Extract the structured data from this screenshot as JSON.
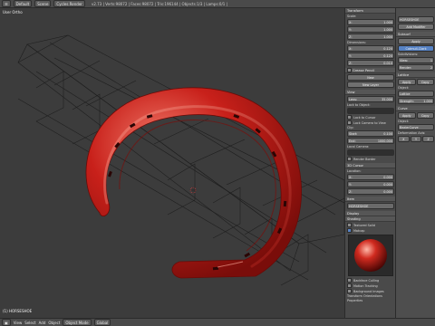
{
  "topbar": {
    "editor_menu": "Default",
    "scene": "Scene",
    "engine": "Cycles Render",
    "stats": "v2.73 | Verts:98072 | Faces:98072 | Tris:196144 | Objects:1/3 | Lamps:0/1 | Mem:44.72M | HORSESHOE"
  },
  "viewport": {
    "label": "User Ortho",
    "object_label": "(1) HORSESHOE"
  },
  "npanel": {
    "header_transform": "Transform",
    "scale_label": "Scale:",
    "scale": [
      {
        "axis": "X:",
        "value": "1.000"
      },
      {
        "axis": "Y:",
        "value": "1.000"
      },
      {
        "axis": "Z:",
        "value": "1.000"
      }
    ],
    "dimensions_label": "Dimensions:",
    "dimensions": [
      {
        "axis": "X:",
        "value": "0.120"
      },
      {
        "axis": "Y:",
        "value": "0.120"
      },
      {
        "axis": "Z:",
        "value": "0.010"
      }
    ],
    "grease_pencil": "Grease Pencil",
    "new_btn": "New",
    "new_layer_btn": "New Layer",
    "view_header": "View",
    "lens_label": "Lens:",
    "lens_value": "35.000",
    "lock_to_object": "Lock to Object:",
    "lock_to_cursor": "Lock to Cursor",
    "lock_camera": "Lock Camera to View",
    "clip_label": "Clip:",
    "clip_start": "0.100",
    "clip_end": "1000.000",
    "local_camera": "Local Camera:",
    "render_border": "Render Border",
    "cursor_3d": "3D Cursor",
    "location_label": "Location:",
    "location": [
      {
        "axis": "X:",
        "value": "0.000"
      },
      {
        "axis": "Y:",
        "value": "0.000"
      },
      {
        "axis": "Z:",
        "value": "0.000"
      }
    ],
    "item_header": "Item",
    "item_name": "HORSESHOE",
    "display": "Display",
    "shading": "Shading",
    "textured_solid": "Textured Solid",
    "matcap": "Matcap",
    "backface_culling": "Backface Culling",
    "motion_tracking": "Motion Tracking",
    "background_images": "Background Images",
    "transform_orientations": "Transform Orientations",
    "properties": "Properties"
  },
  "props": {
    "object_name": "HORSESHOE",
    "add_modifier": "Add Modifier",
    "subsurf": "Subsurf",
    "apply": "Apply",
    "copy": "Copy",
    "catmull_clark": "Catmull-Clark",
    "subdivisions_label": "Subdivisions:",
    "view_label": "View:",
    "view_value": "1",
    "render_label": "Render:",
    "render_value": "2",
    "lattice": "Lattice",
    "object_label": "Object:",
    "lattice_obj": "Lattice",
    "strength_label": "Strength:",
    "strength_value": "1.000",
    "curve": "Curve",
    "curve_obj": "BezierCurve",
    "deformation_axis": "Deformation Axis:"
  },
  "statusbar": {
    "view_btn": "View",
    "select_btn": "Select",
    "add_btn": "Add",
    "object_btn": "Object",
    "mode": "Object Mode",
    "pivot": "Global"
  },
  "colors": {
    "horseshoe": "#c8201a",
    "horseshoe_highlight": "#f07a6a",
    "wire": "#1a1a1a",
    "viewport_bg": "#3c3c3c",
    "accent": "#5682c4"
  },
  "icons": [
    "menu-icon",
    "scene-icon",
    "render-icon",
    "cursor-icon",
    "grid-icon",
    "lock-icon",
    "object-icon",
    "wrench-icon",
    "material-icon",
    "eye-icon",
    "camera-icon"
  ]
}
